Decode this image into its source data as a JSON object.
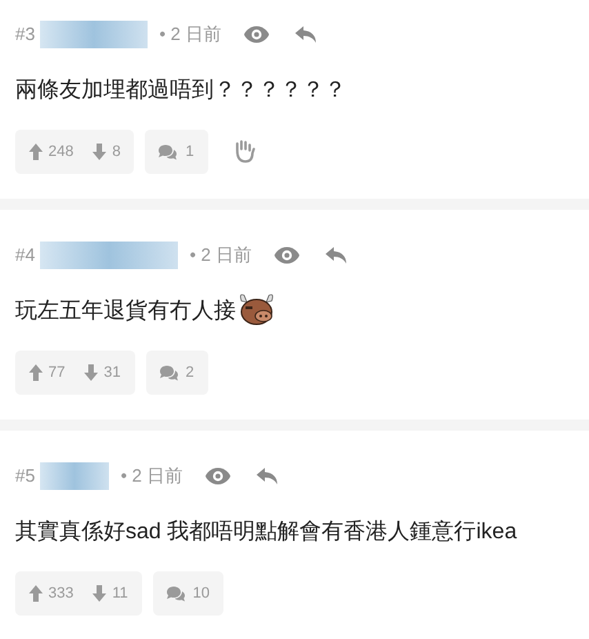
{
  "posts": [
    {
      "number": "#3",
      "time": "• 2 日前",
      "body": "兩條友加埋都過唔到？？？？？？",
      "kind": "plain",
      "upvotes": "248",
      "downvotes": "8",
      "replies": "1",
      "hand": true
    },
    {
      "number": "#4",
      "time": "• 2 日前",
      "body": "玩左五年退貨有冇人接",
      "kind": "bull",
      "upvotes": "77",
      "downvotes": "31",
      "replies": "2",
      "hand": false
    },
    {
      "number": "#5",
      "time": "• 2 日前",
      "body": "其實真係好sad 我都唔明點解會有香港人鍾意行ikea",
      "kind": "plain",
      "upvotes": "333",
      "downvotes": "11",
      "replies": "10",
      "hand": false
    }
  ]
}
